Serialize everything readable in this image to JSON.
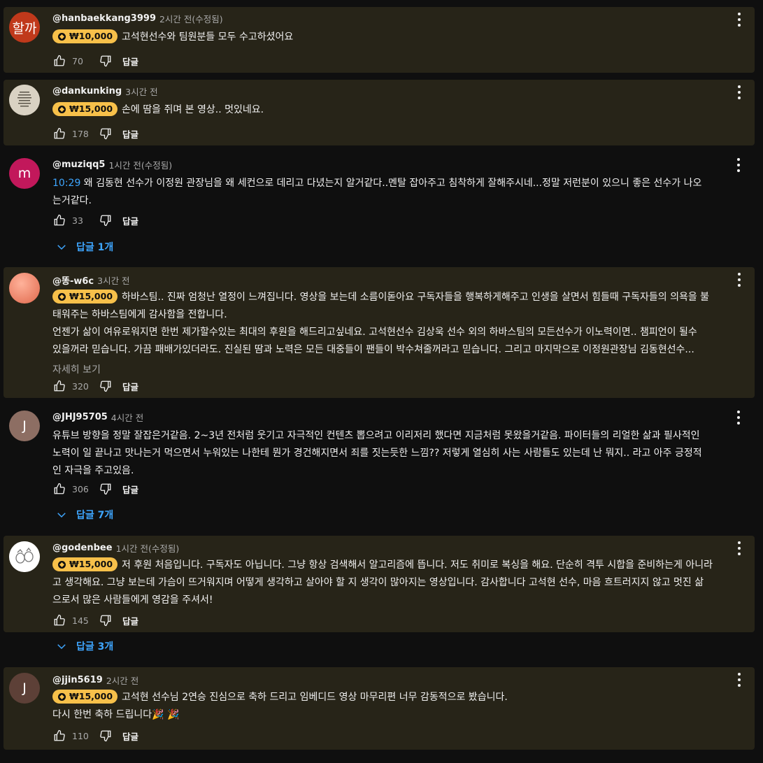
{
  "comments": [
    {
      "author": "@hanbaekkang3999",
      "time": "2시간 전(수정됨)",
      "avatar_text": "할까",
      "avatar_color": "#c0391b",
      "super_amount": "₩10,000",
      "lines": [
        "고석현선수와 팀원분들 모두 수고하셨어요"
      ],
      "likes": "70",
      "reply_label": "답글"
    },
    {
      "author": "@dankunking",
      "time": "3시간 전",
      "avatar_color": "#d8d3c6",
      "super_amount": "₩15,000",
      "lines": [
        "손에 땀을 쥐며 본 영상.. 멋있네요."
      ],
      "likes": "178",
      "reply_label": "답글"
    },
    {
      "author": "@muziqq5",
      "time": "1시간 전(수정됨)",
      "avatar_text": "m",
      "avatar_color": "#c2185b",
      "timestamp_link": "10:29",
      "lines": [
        " 왜 김동현 선수가 이정원 관장님을 왜 세컨으로 데리고 다녔는지 알거같다..멘탈 잡아주고 침착하게 잘해주시네...정말 저런분이 있으니 좋은 선수가 나오",
        "는거같다."
      ],
      "likes": "33",
      "reply_label": "답글",
      "replies_label": "답글 1개"
    },
    {
      "author": "@똥-w6c",
      "time": "3시간 전",
      "avatar_color": "#f08a72",
      "super_amount": "₩15,000",
      "lines": [
        "하바스팀.. 진짜 엄청난 열정이 느껴집니다. 영상을 보는데 소름이돋아요 구독자들을 행복하게해주고 인생을 살면서 힘들때 구독자들의 의욕을 불",
        "태워주는 하바스팀에게 감사함을 전합니다.",
        "언젠가 삶이 여유로워지면 한번 제가할수있는 최대의 후원을 해드리고싶네요. 고석현선수 김상욱 선수 외의 하바스팀의 모든선수가 이노력이면.. 챔피언이 될수",
        "있을꺼라 믿습니다. 가끔 패배가있더라도. 진실된 땀과 노력은 모든 대중들이 팬들이 박수쳐줄꺼라고 믿습니다. 그리고 마지막으로   이정원관장님 김동현선수..."
      ],
      "more_label": "자세히 보기",
      "likes": "320",
      "reply_label": "답글"
    },
    {
      "author": "@JHJ95705",
      "time": "4시간 전",
      "avatar_text": "J",
      "avatar_color": "#8d6e63",
      "lines": [
        "유튜브 방향을 정말 잘잡은거같음. 2~3년 전처럼 웃기고 자극적인 컨텐츠 뽑으려고 이리저리 했다면 지금처럼 못왔을거같음. 파이터들의 리얼한 삶과 필사적인",
        "노력이 일 끝나고 맛나는거 먹으면서 누워있는 나한테 뭔가 경건해지면서 죄를 짓는듯한 느낌?? 저렇게 열심히 사는 사람들도 있는데 난 뭐지.. 라고 아주 긍정적",
        "인 자극을 주고있음."
      ],
      "likes": "306",
      "reply_label": "답글",
      "replies_label": "답글 7개"
    },
    {
      "author": "@godenbee",
      "time": "1시간 전(수정됨)",
      "avatar_color": "#ffffff",
      "super_amount": "₩15,000",
      "lines": [
        "저 후원 처음입니다. 구독자도 아닙니다. 그냥 항상 검색해서 알고리즘에 뜹니다. 저도 취미로 복싱을 해요. 단순히 격투 시합을 준비하는게 아니라",
        "고 생각해요. 그냥 보는데 가슴이 뜨거워지며 어떻게 생각하고 살아야 할 지 생각이 많아지는 영상입니다. 감사합니다 고석현 선수, 마음 흐트러지지 않고 멋진 삶",
        "으로서 많은 사람들에게 영감을 주셔서!"
      ],
      "likes": "145",
      "reply_label": "답글",
      "replies_label": "답글 3개"
    },
    {
      "author": "@jjin5619",
      "time": "2시간 전",
      "avatar_text": "J",
      "avatar_color": "#5d4037",
      "super_amount": "₩15,000",
      "lines": [
        "고석현 선수님 2연승 진심으로 축하 드리고 임베디드 영상 마무리편 너무 감동적으로 봤습니다.",
        "다시 한번 축하 드립니다🎉 🎉"
      ],
      "likes": "110",
      "reply_label": "답글"
    }
  ]
}
